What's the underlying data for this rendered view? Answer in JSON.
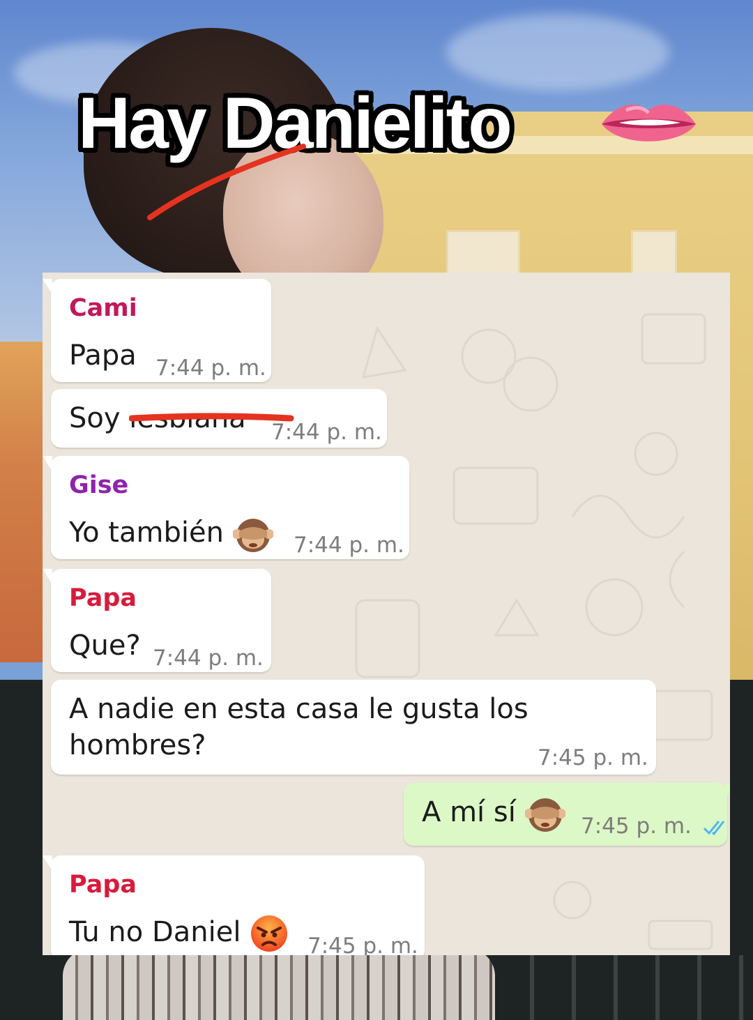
{
  "overlay": {
    "title": "Hay Danielito",
    "title_emoji": "lips-biting-emoji"
  },
  "chat": {
    "messages": [
      {
        "sender": "Cami",
        "sender_color": "#c2185b",
        "text": "Papa",
        "time": "7:44 p. m.",
        "direction": "in"
      },
      {
        "sender": "",
        "text": "Soy lesbiana",
        "text_struck": true,
        "time": "7:44 p. m.",
        "direction": "in"
      },
      {
        "sender": "Gise",
        "sender_color": "#8e24aa",
        "text": "Yo también",
        "emoji": "see-no-evil-monkey-emoji",
        "time": "7:44 p. m.",
        "direction": "in"
      },
      {
        "sender": "Papa",
        "sender_color": "#d81b3c",
        "text": "Que?",
        "time": "7:44 p. m.",
        "direction": "in"
      },
      {
        "sender": "",
        "text_line1": "A nadie en esta casa le gusta los",
        "text_line2": "hombres?",
        "time": "7:45 p. m.",
        "direction": "in"
      },
      {
        "sender": "",
        "text": "A mí sí",
        "emoji": "see-no-evil-monkey-emoji",
        "time": "7:45 p. m.",
        "direction": "out",
        "status": "read",
        "status_color": "#4fb6ec"
      },
      {
        "sender": "Papa",
        "sender_color": "#d81b3c",
        "text": "Tu no Daniel",
        "emoji": "angry-face-emoji",
        "time": "7:45 p. m.",
        "direction": "in"
      }
    ]
  },
  "colors": {
    "chat_background": "#ece5dc",
    "incoming_bubble": "#ffffff",
    "outgoing_bubble": "#dcf8c6",
    "strike_red": "#e53320"
  }
}
